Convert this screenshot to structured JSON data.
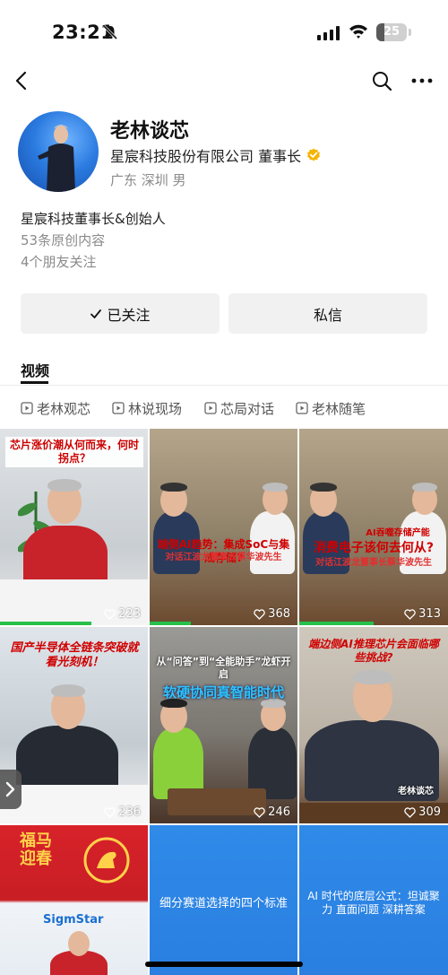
{
  "status_bar": {
    "time": "23:21",
    "battery_percent": "25",
    "battery_level": 0.25
  },
  "profile": {
    "name": "老林谈芯",
    "verification": "星宸科技股份有限公司 董事长",
    "meta": "广东 深圳 男",
    "bio_title": "星宸科技董事长&创始人",
    "original_count": "53条原创内容",
    "friends_following": "4个朋友关注"
  },
  "actions": {
    "follow_label": "已关注",
    "message_label": "私信"
  },
  "tabs": {
    "video": "视频"
  },
  "chips": [
    "老林观芯",
    "林说现场",
    "芯局对话",
    "老林随笔"
  ],
  "videos": [
    {
      "likes": "223",
      "caption": "芯片涨价潮从何而来，何时拐点？",
      "progress": 0.62,
      "theme": "red-shirt"
    },
    {
      "likes": "368",
      "caption": "端侧AI趋势：集成SoC与集成存储?",
      "subcaption": "对话江波龙董事长蔡华波先生",
      "progress": 0.28,
      "theme": "dialogue"
    },
    {
      "likes": "313",
      "caption": "消费电子该何去何从?",
      "subcaption": "对话江波龙董事长蔡华波先生",
      "topline": "AI吞噬存储产能",
      "progress": 0.5,
      "theme": "dialogue"
    },
    {
      "likes": "236",
      "caption": "国产半导体全链条突破就看光刻机！",
      "progress": 0,
      "theme": "office"
    },
    {
      "likes": "246",
      "caption": "软硬协同真智能时代",
      "topline": "从“问答”到“全能助手”龙虾开启",
      "progress": 0,
      "theme": "studio"
    },
    {
      "likes": "309",
      "caption": "端边侧AI推理芯片会面临哪些挑战?",
      "watermark": "老林谈芯",
      "progress": 0,
      "theme": "tea"
    },
    {
      "likes": "",
      "caption": "福马迎春",
      "progress": 0,
      "theme": "newyear"
    },
    {
      "likes": "",
      "caption": "细分赛道选择的四个标准",
      "progress": 0,
      "theme": "blue"
    },
    {
      "likes": "",
      "caption": "AI 时代的底层公式：坦诚聚力 直面问题 深耕答案",
      "progress": 0,
      "theme": "blue"
    }
  ],
  "colors": {
    "accent_green": "#27c04a",
    "verified_gold": "#f5b400",
    "button_bg": "#f1f1f1"
  }
}
